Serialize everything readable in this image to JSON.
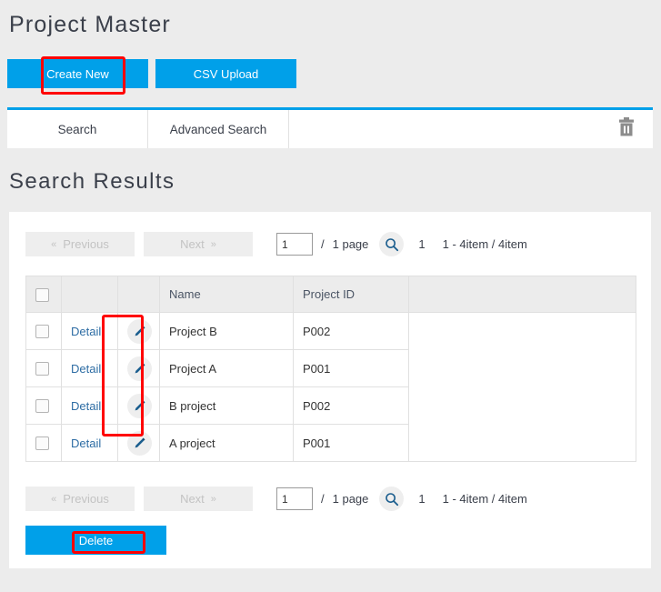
{
  "page": {
    "title": "Project Master",
    "section_heading": "Search Results",
    "accent_color": "#00a0e9",
    "background_color": "#ececec",
    "annotation_color": "#ff0000"
  },
  "actions": {
    "create_new_label": "Create New",
    "csv_upload_label": "CSV Upload",
    "delete_label": "Delete"
  },
  "tabs": {
    "items": [
      {
        "label": "Search"
      },
      {
        "label": "Advanced Search"
      }
    ],
    "trash_icon": "trash-icon"
  },
  "pager": {
    "previous_label": "Previous",
    "previous_chevron": "«",
    "next_label": "Next",
    "next_chevron": "»",
    "page_input_value": "1",
    "page_separator": "/",
    "page_total_label": "1 page",
    "search_icon": "search-icon",
    "current_page": "1",
    "item_range": "1 - 4item / 4item"
  },
  "table": {
    "headers": {
      "select_all": "",
      "detail": "",
      "edit": "",
      "name": "Name",
      "project_id": "Project ID",
      "blank": ""
    },
    "rows": [
      {
        "detail": "Detail",
        "edit_icon": "pencil-icon",
        "name": "Project B",
        "project_id": "P002"
      },
      {
        "detail": "Detail",
        "edit_icon": "pencil-icon",
        "name": "Project A",
        "project_id": "P001"
      },
      {
        "detail": "Detail",
        "edit_icon": "pencil-icon",
        "name": "B project",
        "project_id": "P002"
      },
      {
        "detail": "Detail",
        "edit_icon": "pencil-icon",
        "name": "A project",
        "project_id": "P001"
      }
    ]
  },
  "annotations": [
    {
      "target": "create-new-button"
    },
    {
      "target": "edit-icon-column"
    },
    {
      "target": "delete-button"
    }
  ]
}
